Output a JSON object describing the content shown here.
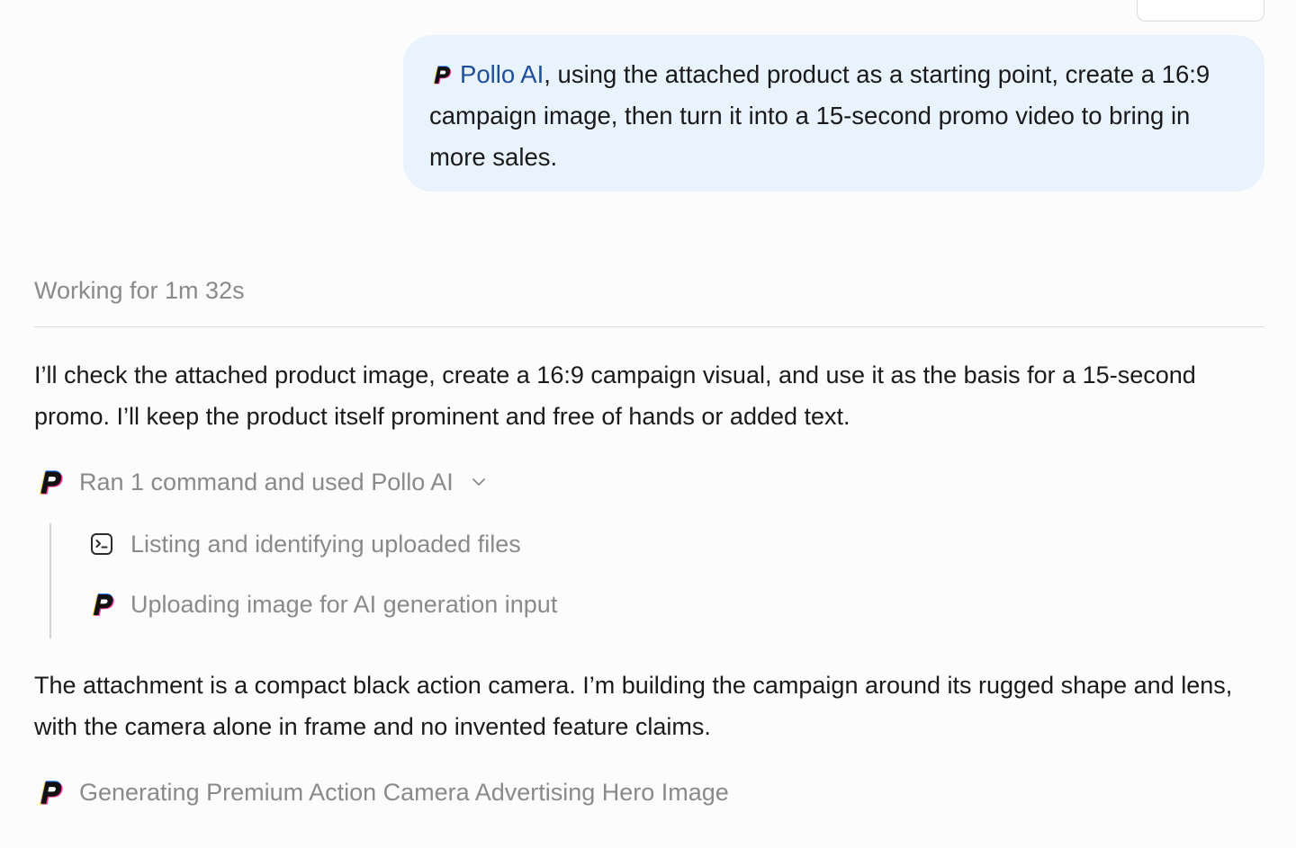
{
  "attachment": {
    "icon": "image-thumbnail"
  },
  "user_message": {
    "mention": "Pollo AI",
    "text": ", using the attached product as a starting point, create a 16:9 campaign image, then turn it into a 15-second promo video to bring in more sales."
  },
  "assistant": {
    "status": "Working for 1m 32s",
    "paragraph_1": "I’ll check the attached product image, create a 16:9 campaign visual, and use it as the basis for a 15-second promo. I’ll keep the product itself prominent and free of hands or added text.",
    "tool_group": {
      "label": "Ran 1 command and used Pollo AI",
      "icon": "pollo-ai-logo-icon",
      "expand_icon": "chevron-down-icon",
      "steps": [
        {
          "label": "Listing and identifying uploaded files",
          "icon": "terminal-icon"
        },
        {
          "label": "Uploading image for AI generation input",
          "icon": "pollo-ai-logo-icon"
        }
      ]
    },
    "paragraph_2": "The attachment is a compact black action camera. I’m building the campaign around its rugged shape and lens, with the camera alone in frame and no invented feature claims.",
    "generating": {
      "label": "Generating Premium Action Camera Advertising Hero Image",
      "icon": "pollo-ai-logo-icon"
    }
  },
  "colors": {
    "bubble_bg": "#e8f3fd",
    "mention": "#1f4e9c",
    "muted_text": "#8a8a8a",
    "body_text": "#1a1a1a"
  }
}
